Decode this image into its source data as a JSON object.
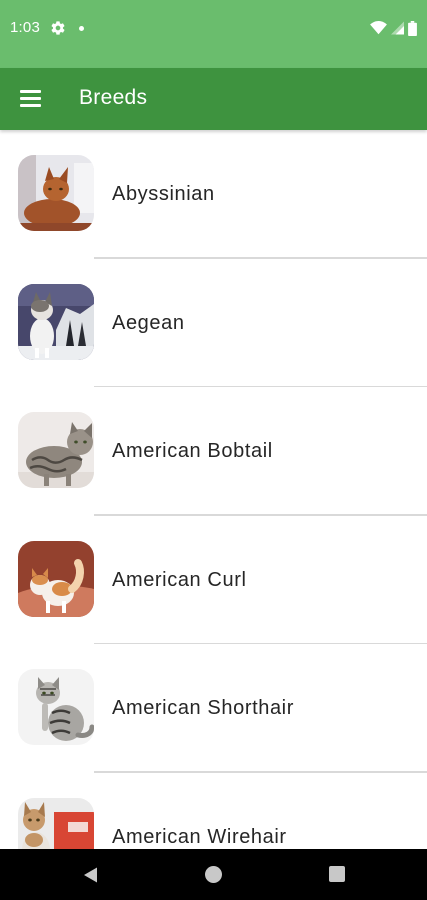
{
  "status_bar": {
    "time": "1:03",
    "icons": [
      "settings-gear-icon",
      "notification-dot-icon",
      "wifi-icon",
      "cell-signal-icon",
      "battery-icon"
    ]
  },
  "app_bar": {
    "menu_icon": "hamburger-menu-icon",
    "title": "Breeds"
  },
  "breeds": [
    {
      "name": "Abyssinian",
      "icon": "abyssinian-cat-photo"
    },
    {
      "name": "Aegean",
      "icon": "aegean-cat-photo"
    },
    {
      "name": "American Bobtail",
      "icon": "american-bobtail-cat-photo"
    },
    {
      "name": "American Curl",
      "icon": "american-curl-cat-photo"
    },
    {
      "name": "American Shorthair",
      "icon": "american-shorthair-cat-photo"
    },
    {
      "name": "American Wirehair",
      "icon": "american-wirehair-cat-photo"
    }
  ],
  "nav_bar": {
    "icons": [
      "back-icon",
      "home-icon",
      "recents-icon"
    ]
  },
  "colors": {
    "status_bar": "#6abd6d",
    "app_bar": "#3e933f",
    "nav_bar": "#000000",
    "divider": "#d9d9d9",
    "text": "#262626"
  }
}
